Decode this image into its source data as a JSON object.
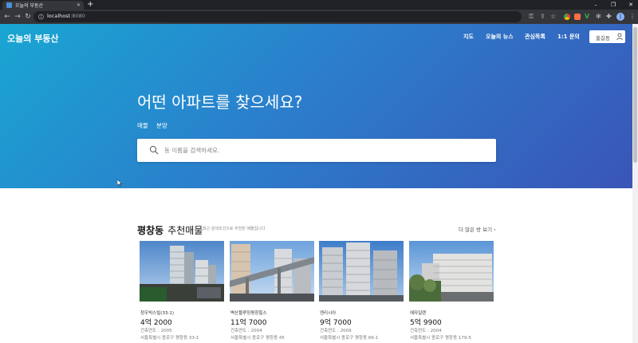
{
  "browser": {
    "tab_title": "오늘의 부동산",
    "url_host": "localhost",
    "url_port": ":8080"
  },
  "header": {
    "brand": "오늘의 부동산",
    "nav": [
      "지도",
      "오늘의 뉴스",
      "관심목록",
      "1:1 문의"
    ],
    "user_label": "홍길동"
  },
  "hero": {
    "headline": "어떤 아파트를 찾으세요?",
    "tabs": [
      "매물",
      "분양"
    ],
    "search_placeholder": "동 이름을 검색하세요."
  },
  "section": {
    "title_bold": "평창동",
    "title_rest": "추천매물",
    "subtitle": "최근 검색조건으로 추천한 매물입니다",
    "more_label": "더 많은 방 보기"
  },
  "listings": [
    {
      "name": "청우빅스빌(33-1)",
      "price": "4억 2000",
      "year": "건축연도 : 2005",
      "address": "서울특별시 종로구 평창동 33-1"
    },
    {
      "name": "벽산블루밍평창힐스",
      "price": "11억 7000",
      "year": "건축연도 : 2004",
      "address": "서울특별시 종로구 평창동 45"
    },
    {
      "name": "엔리시아",
      "price": "9억 7000",
      "year": "건축연도 : 2009",
      "address": "서울특별시 종로구 평창동 66-1"
    },
    {
      "name": "에자일랜",
      "price": "5억 9900",
      "year": "건축연도 : 2004",
      "address": "서울특별시 종로구 평창동 179-5"
    }
  ],
  "colors": {
    "hero_start": "#19a6d2",
    "hero_end": "#3a55b7",
    "browser_dark": "#202124"
  }
}
